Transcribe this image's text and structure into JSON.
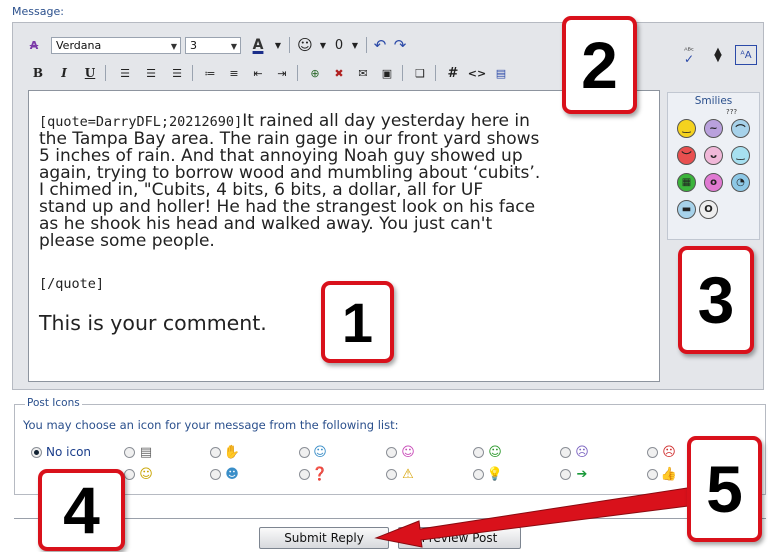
{
  "message_label": "Message:",
  "toolbar": {
    "font_name": "Verdana",
    "font_size": "3",
    "text_color_label": "A",
    "bold": "B",
    "italic": "I",
    "underline": "U",
    "hash": "#",
    "code": "<>"
  },
  "editor": {
    "quote_open": "[quote=DarryDFL;20212690]",
    "quote_first": "It rained all day yesterday here in",
    "quote_lines": [
      "the Tampa Bay area. The rain gage in our front yard shows",
      "5 inches of rain. And that annoying Noah guy showed up",
      "again, trying to borrow wood and mumbling about ‘cubits’.",
      "I chimed in, \"Cubits, 4 bits, 6 bits, a dollar, all for UF",
      "stand up and holler! He had the strangest look on his face",
      "as he shook his head and walked away. You just can't",
      "please some people."
    ],
    "quote_close": "[/quote]",
    "comment": "This is your comment."
  },
  "smilies": {
    "title": "Smilies",
    "more_label": "???"
  },
  "post_icons": {
    "legend": "Post Icons",
    "description": "You may choose an icon for your message from the following list:",
    "no_icon_label": "No icon"
  },
  "buttons": {
    "submit": "Submit Reply",
    "preview": "Preview Post"
  },
  "callouts": [
    "1",
    "2",
    "3",
    "4",
    "5"
  ],
  "colors": {
    "accent_blue": "#2a4f8c",
    "callout_red": "#d9111b"
  }
}
